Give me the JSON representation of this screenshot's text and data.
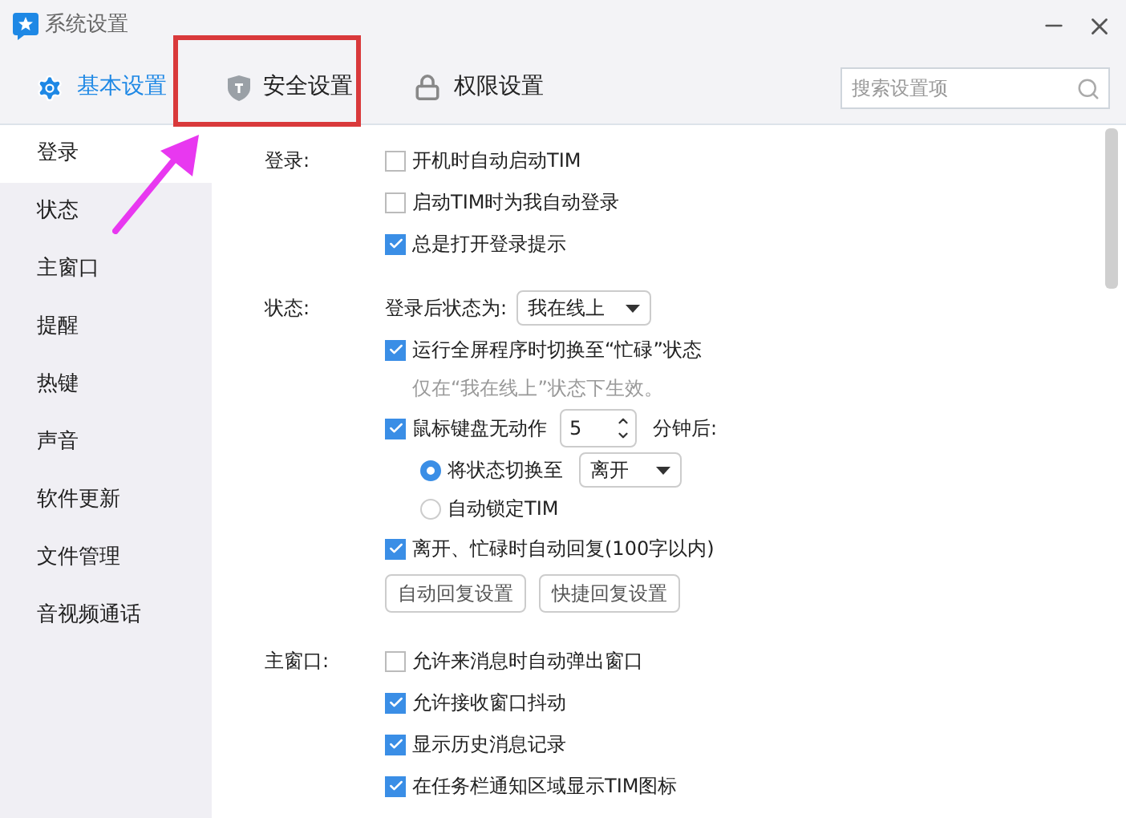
{
  "window": {
    "title": "系统设置"
  },
  "tabs": [
    {
      "label": "基本设置",
      "selected": true,
      "kind": "gear"
    },
    {
      "label": "安全设置",
      "selected": false,
      "kind": "shield"
    },
    {
      "label": "权限设置",
      "selected": false,
      "kind": "lock"
    }
  ],
  "search": {
    "placeholder": "搜索设置项"
  },
  "sidebar": {
    "items": [
      {
        "label": "登录",
        "selected": true
      },
      {
        "label": "状态",
        "selected": false
      },
      {
        "label": "主窗口",
        "selected": false
      },
      {
        "label": "提醒",
        "selected": false
      },
      {
        "label": "热键",
        "selected": false
      },
      {
        "label": "声音",
        "selected": false
      },
      {
        "label": "软件更新",
        "selected": false
      },
      {
        "label": "文件管理",
        "selected": false
      },
      {
        "label": "音视频通话",
        "selected": false
      }
    ]
  },
  "sections": [
    {
      "label": "登录:",
      "items": [
        {
          "kind": "checkbox",
          "label": "开机时自动启动TIM",
          "checked": false
        },
        {
          "kind": "checkbox",
          "label": "启动TIM时为我自动登录",
          "checked": false
        },
        {
          "kind": "checkbox",
          "label": "总是打开登录提示",
          "checked": true
        }
      ]
    },
    {
      "label": "状态:",
      "items": [
        {
          "kind": "select",
          "label": "登录后状态为:",
          "value": "我在线上"
        },
        {
          "kind": "checkbox",
          "label": "运行全屏程序时切换至“忙碌”状态",
          "checked": true
        },
        {
          "kind": "note",
          "label": "仅在“我在线上”状态下生效。"
        },
        {
          "kind": "spinner",
          "label": "鼠标键盘无动作",
          "checked": true,
          "value": "5",
          "suffix": "分钟后:"
        },
        {
          "kind": "radio",
          "label": "将状态切换至",
          "selected": true,
          "value": "离开"
        },
        {
          "kind": "radio",
          "label": "自动锁定TIM",
          "selected": false
        },
        {
          "kind": "checkbox",
          "label": "离开、忙碌时自动回复(100字以内)",
          "checked": true
        },
        {
          "kind": "buttons",
          "buttons": [
            "自动回复设置",
            "快捷回复设置"
          ]
        }
      ]
    },
    {
      "label": "主窗口:",
      "items": [
        {
          "kind": "checkbox",
          "label": "允许来消息时自动弹出窗口",
          "checked": false
        },
        {
          "kind": "checkbox",
          "label": "允许接收窗口抖动",
          "checked": true
        },
        {
          "kind": "checkbox",
          "label": "显示历史消息记录",
          "checked": true
        },
        {
          "kind": "checkbox",
          "label": "在任务栏通知区域显示TIM图标",
          "checked": true
        }
      ]
    }
  ]
}
